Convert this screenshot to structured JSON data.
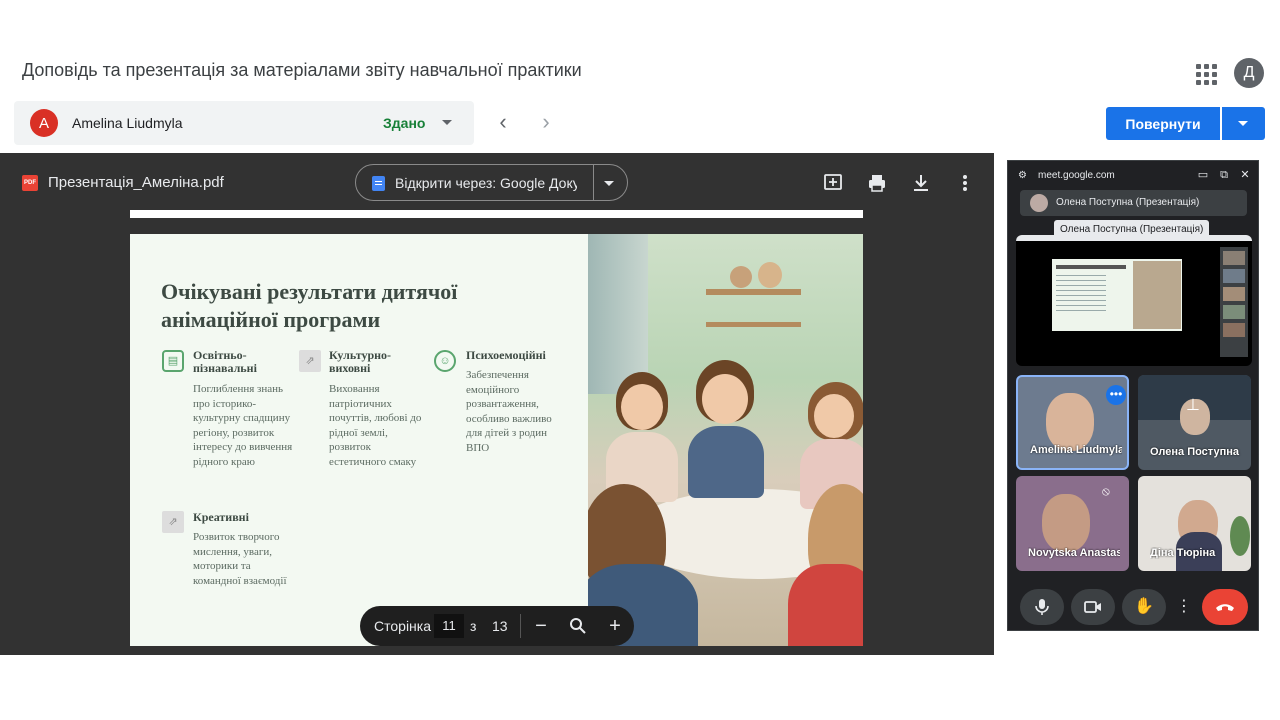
{
  "header": {
    "title": "Доповідь та презентація за матеріалами звіту навчальної практики",
    "apps_icon": "apps-grid-icon",
    "account_initial": "Д"
  },
  "student": {
    "initial": "A",
    "name": "Amelina Liudmyla",
    "status": "Здано",
    "avatar_color": "#d93025",
    "status_color": "#188038"
  },
  "actions": {
    "return_label": "Повернути",
    "accent": "#1a73e8"
  },
  "viewer": {
    "file_name": "Презентація_Амеліна.pdf",
    "file_badge": "PDF",
    "open_with": "Відкрити через: Google Документи",
    "pager": {
      "label": "Сторінка",
      "current": "11",
      "of": "з",
      "total": "13"
    }
  },
  "slide": {
    "title": "Очікувані результати дитячої анімаційної програми",
    "columns": [
      {
        "title": "Освітньо-пізнавальні",
        "text": "Поглиблення знань про історико-культурну спадщину регіону, розвиток інтересу до вивчення рідного краю",
        "icon": "book-icon"
      },
      {
        "title": "Культурно-виховні",
        "text": "Виховання патріотичних почуттів, любові до рідної землі, розвиток естетичного смаку",
        "icon": "image-placeholder-icon"
      },
      {
        "title": "Психоемоційні",
        "text": "Забезпечення емоційного розвантаження, особливо важливо для дітей з родин ВПО",
        "icon": "masks-icon"
      },
      {
        "title": "Креативні",
        "text": "Розвиток творчого мислення, уваги, моторики та командної взаємодії",
        "icon": "image-placeholder-icon"
      }
    ]
  },
  "meet": {
    "url": "meet.google.com",
    "presenter": "Олена Поступна (Презентація)",
    "tooltip": "Олена Поступна (Презентація)",
    "participants": [
      {
        "name": "Amelina Liudmyla",
        "muted": false,
        "highlighted": true
      },
      {
        "name": "Олена Поступна",
        "muted": false,
        "highlighted": false
      },
      {
        "name": "Novytska Anastasiia",
        "muted": true,
        "highlighted": false
      },
      {
        "name": "Діна Тюріна",
        "muted": false,
        "highlighted": false
      }
    ],
    "controls": [
      "mic-icon",
      "camera-icon",
      "raise-hand-icon",
      "more-icon",
      "end-call-icon"
    ],
    "end_call_color": "#ea4335"
  }
}
